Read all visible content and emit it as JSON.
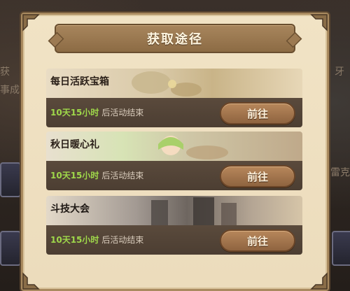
{
  "background": {
    "left_fragments": [
      "获",
      "事成"
    ],
    "right_fragments": [
      "牙",
      "雷克"
    ]
  },
  "dialog": {
    "title": "获取途径"
  },
  "rows": [
    {
      "name": "每日活跃宝箱",
      "time_highlight": "10天15小时",
      "time_suffix": "后活动结束",
      "button_label": "前往"
    },
    {
      "name": "秋日暖心礼",
      "time_highlight": "10天15小时",
      "time_suffix": "后活动结束",
      "button_label": "前往"
    },
    {
      "name": "斗技大会",
      "time_highlight": "10天15小时",
      "time_suffix": "后活动结束",
      "button_label": "前往"
    }
  ],
  "colors": {
    "highlight_green": "#9fd84a",
    "panel_parchment": "#f1e3c5",
    "button_brown": "#a67a50"
  }
}
